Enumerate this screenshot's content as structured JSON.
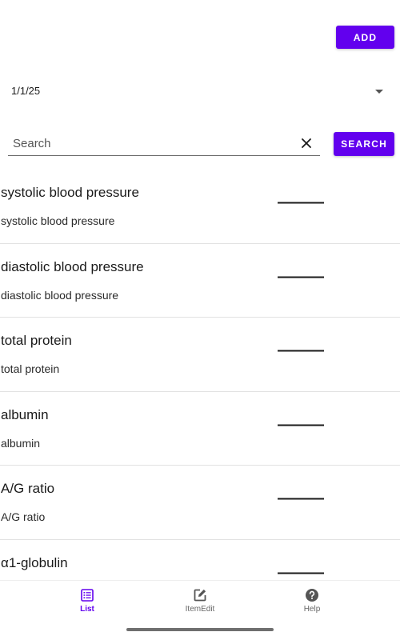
{
  "toolbar": {
    "add_label": "ADD"
  },
  "date_selector": {
    "value": "1/1/25"
  },
  "search": {
    "placeholder": "Search",
    "value": "",
    "button_label": "SEARCH"
  },
  "list": {
    "items": [
      {
        "title": "systolic blood pressure",
        "subtitle": "systolic blood pressure",
        "value": "———"
      },
      {
        "title": "diastolic blood pressure",
        "subtitle": "diastolic blood pressure",
        "value": "———"
      },
      {
        "title": "total protein",
        "subtitle": "total protein",
        "value": "———"
      },
      {
        "title": "albumin",
        "subtitle": "albumin",
        "value": "———"
      },
      {
        "title": "A/G ratio",
        "subtitle": "A/G ratio",
        "value": "———"
      },
      {
        "title": "α1-globulin",
        "subtitle": "",
        "value": "———"
      }
    ]
  },
  "bottom_nav": {
    "items": [
      {
        "label": "List",
        "icon": "list-icon",
        "active": true
      },
      {
        "label": "ItemEdit",
        "icon": "edit-icon",
        "active": false
      },
      {
        "label": "Help",
        "icon": "help-icon",
        "active": false
      }
    ]
  },
  "colors": {
    "primary": "#6200ee",
    "text": "#1a1a1a",
    "divider": "#e2e2e2",
    "nav_inactive": "#666666"
  }
}
